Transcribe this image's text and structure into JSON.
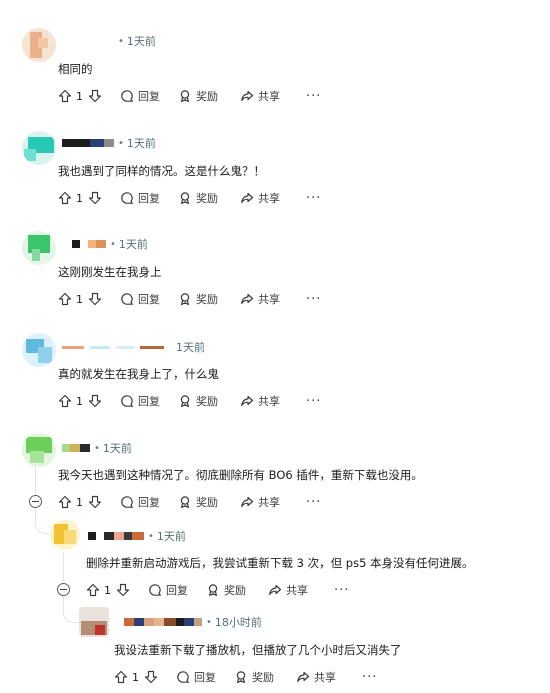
{
  "labels": {
    "reply": "回复",
    "award": "奖励",
    "share": "共享",
    "more": "···"
  },
  "colors": {
    "text": "#1a1a1b",
    "meta": "#576f76",
    "action": "#3c3c3c",
    "thread_line": "#e3e3e3"
  },
  "icons": {
    "upvote": "arrow-up-icon",
    "downvote": "arrow-down-icon",
    "reply": "chat-bubble-icon",
    "award": "award-icon",
    "share": "share-arrow-icon",
    "collapse": "minus-circle-icon"
  },
  "comments": [
    {
      "time": "1天前",
      "body": "相同的",
      "score": "1"
    },
    {
      "time": "1天前",
      "body": "我也遇到了同样的情况。这是什么鬼？！",
      "score": "1"
    },
    {
      "time": "1天前",
      "body": "这刚刚发生在我身上",
      "score": "1"
    },
    {
      "time": "1天前",
      "body": "真的就发生在我身上了，什么鬼",
      "score": "1"
    },
    {
      "time": "1天前",
      "body": "我今天也遇到这种情况了。彻底删除所有 BO6 插件，重新下载也没用。",
      "score": "1"
    },
    {
      "time": "1天前",
      "body": "删除并重新启动游戏后，我尝试重新下载 3 次，但 ps5 本身没有任何进展。",
      "score": "1"
    },
    {
      "time": "18小时前",
      "body": "我设法重新下载了播放机，但播放了几个小时后又消失了",
      "score": "1"
    }
  ]
}
